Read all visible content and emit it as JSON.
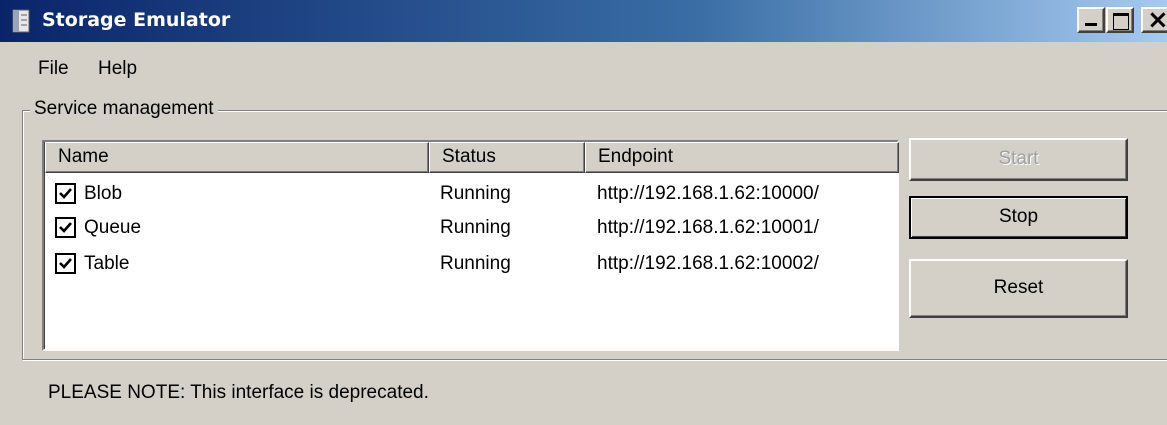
{
  "window": {
    "title": "Storage Emulator",
    "icon": "storage-emulator-app-icon"
  },
  "menu": {
    "items": [
      {
        "label": "File"
      },
      {
        "label": "Help"
      }
    ]
  },
  "service_management": {
    "group_label": "Service management",
    "columns": [
      "Name",
      "Status",
      "Endpoint"
    ],
    "services": [
      {
        "name": "Blob",
        "checked": true,
        "status": "Running",
        "endpoint": "http://192.168.1.62:10000/"
      },
      {
        "name": "Queue",
        "checked": true,
        "status": "Running",
        "endpoint": "http://192.168.1.62:10001/"
      },
      {
        "name": "Table",
        "checked": true,
        "status": "Running",
        "endpoint": "http://192.168.1.62:10002/"
      }
    ],
    "buttons": {
      "start": "Start",
      "stop": "Stop",
      "reset": "Reset"
    },
    "start_enabled": false
  },
  "note": "PLEASE NOTE:  This interface is deprecated.",
  "colors": {
    "titlebar_start": "#0a246a",
    "titlebar_end": "#a6caf0",
    "window_bg": "#d4d0c8"
  }
}
